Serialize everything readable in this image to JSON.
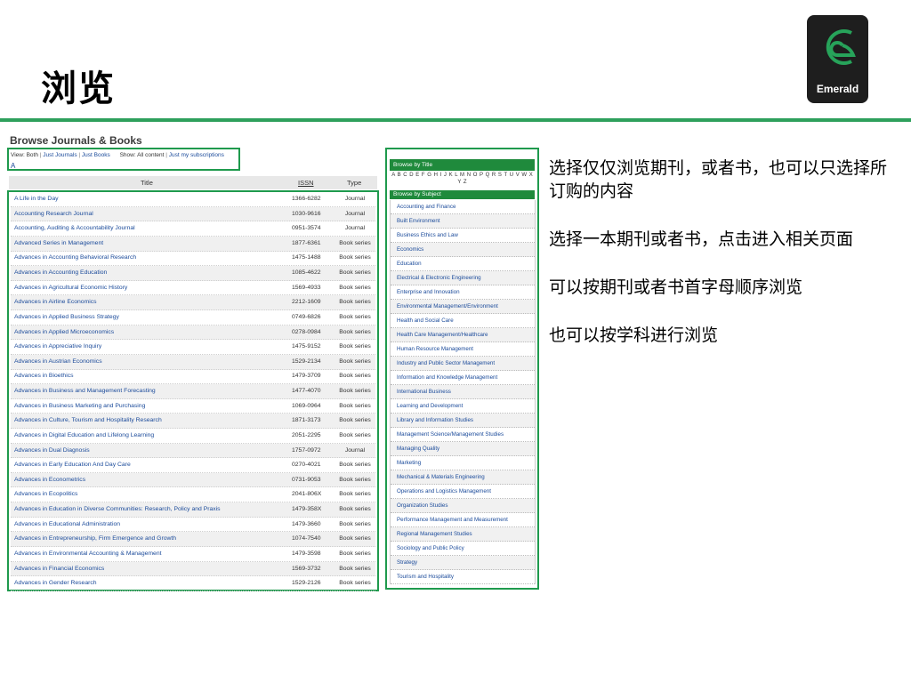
{
  "slide": {
    "title": "浏览",
    "logo_text": "Emerald",
    "notes": [
      "选择仅仅浏览期刊，或者书，也可以只选择所订购的内容",
      "选择一本期刊或者书，点击进入相关页面",
      "可以按期刊或者书首字母顺序浏览",
      "也可以按学科进行浏览"
    ]
  },
  "browse": {
    "heading": "Browse Journals & Books",
    "view_label": "View: Both",
    "view_journals": "Just Journals",
    "view_books": "Just Books",
    "show_label": "Show: All content",
    "show_subscriptions": "Just my subscriptions",
    "separator": "|",
    "current_letter": "A"
  },
  "table": {
    "headers": {
      "title": "Title",
      "issn": "ISSN",
      "type": "Type"
    },
    "rows": [
      {
        "title": "A Life in the Day",
        "issn": "1366-6282",
        "type": "Journal"
      },
      {
        "title": "Accounting Research Journal",
        "issn": "1030-9616",
        "type": "Journal"
      },
      {
        "title": "Accounting, Auditing & Accountability Journal",
        "issn": "0951-3574",
        "type": "Journal"
      },
      {
        "title": "Advanced Series in Management",
        "issn": "1877-6361",
        "type": "Book series"
      },
      {
        "title": "Advances in Accounting Behavioral Research",
        "issn": "1475-1488",
        "type": "Book series"
      },
      {
        "title": "Advances in Accounting Education",
        "issn": "1085-4622",
        "type": "Book series"
      },
      {
        "title": "Advances in Agricultural Economic History",
        "issn": "1569-4933",
        "type": "Book series"
      },
      {
        "title": "Advances in Airline Economics",
        "issn": "2212-1609",
        "type": "Book series"
      },
      {
        "title": "Advances in Applied Business Strategy",
        "issn": "0749-6826",
        "type": "Book series"
      },
      {
        "title": "Advances in Applied Microeconomics",
        "issn": "0278-0984",
        "type": "Book series"
      },
      {
        "title": "Advances in Appreciative Inquiry",
        "issn": "1475-9152",
        "type": "Book series"
      },
      {
        "title": "Advances in Austrian Economics",
        "issn": "1529-2134",
        "type": "Book series"
      },
      {
        "title": "Advances in Bioethics",
        "issn": "1479-3709",
        "type": "Book series"
      },
      {
        "title": "Advances in Business and Management Forecasting",
        "issn": "1477-4070",
        "type": "Book series"
      },
      {
        "title": "Advances in Business Marketing and Purchasing",
        "issn": "1069-0964",
        "type": "Book series"
      },
      {
        "title": "Advances in Culture, Tourism and Hospitality Research",
        "issn": "1871-3173",
        "type": "Book series"
      },
      {
        "title": "Advances in Digital Education and Lifelong Learning",
        "issn": "2051-2295",
        "type": "Book series"
      },
      {
        "title": "Advances in Dual Diagnosis",
        "issn": "1757-0972",
        "type": "Journal"
      },
      {
        "title": "Advances in Early Education And Day Care",
        "issn": "0270-4021",
        "type": "Book series"
      },
      {
        "title": "Advances in Econometrics",
        "issn": "0731-9053",
        "type": "Book series"
      },
      {
        "title": "Advances in Ecopolitics",
        "issn": "2041-806X",
        "type": "Book series"
      },
      {
        "title": "Advances in Education in Diverse Communities: Research, Policy and Praxis",
        "issn": "1479-358X",
        "type": "Book series"
      },
      {
        "title": "Advances in Educational Administration",
        "issn": "1479-3660",
        "type": "Book series"
      },
      {
        "title": "Advances in Entrepreneurship, Firm Emergence and Growth",
        "issn": "1074-7540",
        "type": "Book series"
      },
      {
        "title": "Advances in Environmental Accounting & Management",
        "issn": "1479-3598",
        "type": "Book series"
      },
      {
        "title": "Advances in Financial Economics",
        "issn": "1569-3732",
        "type": "Book series"
      },
      {
        "title": "Advances in Gender Research",
        "issn": "1529-2126",
        "type": "Book series"
      }
    ]
  },
  "sidebar": {
    "browse_title": "Browse by Title",
    "alphabet": "A B C D E F G H I J K L M N O P Q R S T U V W X Y Z",
    "browse_subject": "Browse by Subject",
    "subjects": [
      "Accounting and Finance",
      "Built Environment",
      "Business Ethics and Law",
      "Economics",
      "Education",
      "Electrical & Electronic Engineering",
      "Enterprise and Innovation",
      "Environmental Management/Environment",
      "Health and Social Care",
      "Health Care Management/Healthcare",
      "Human Resource Management",
      "Industry and Public Sector Management",
      "Information and Knowledge Management",
      "International Business",
      "Learning and Development",
      "Library and Information Studies",
      "Management Science/Management Studies",
      "Managing Quality",
      "Marketing",
      "Mechanical & Materials Engineering",
      "Operations and Logistics Management",
      "Organization Studies",
      "Performance Management and Measurement",
      "Regional Management Studies",
      "Sociology and Public Policy",
      "Strategy",
      "Tourism and Hospitality"
    ]
  },
  "colors": {
    "accent": "#2ea05c",
    "box_border": "#1f9a4d",
    "link": "#1a4a9a",
    "logo_bg": "#1e1e1e"
  }
}
